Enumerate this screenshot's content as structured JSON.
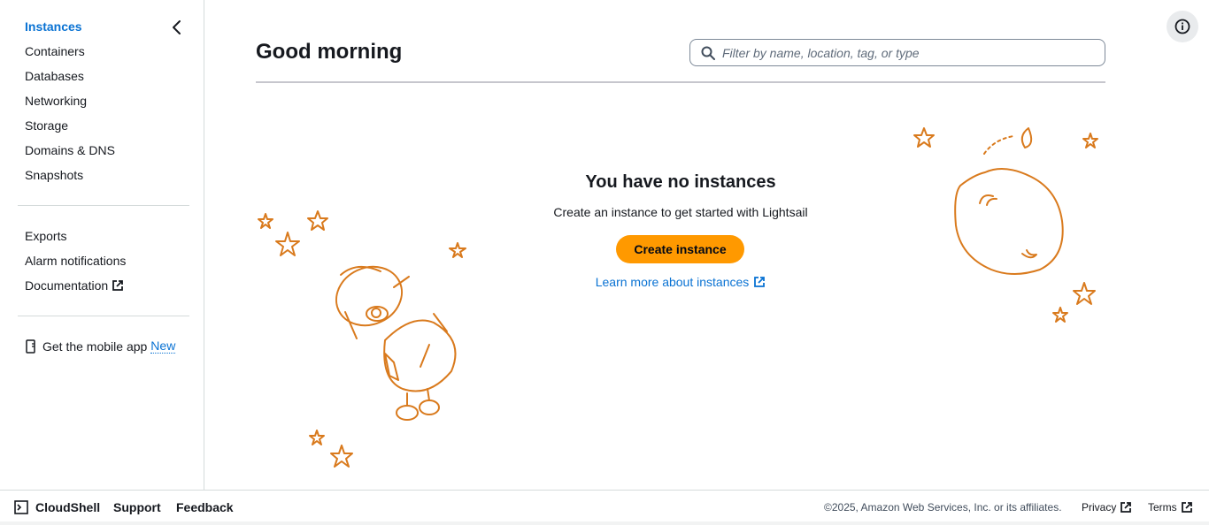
{
  "sidebar": {
    "items": [
      {
        "label": "Instances",
        "active": true
      },
      {
        "label": "Containers"
      },
      {
        "label": "Databases"
      },
      {
        "label": "Networking"
      },
      {
        "label": "Storage"
      },
      {
        "label": "Domains & DNS"
      },
      {
        "label": "Snapshots"
      }
    ],
    "secondary": [
      {
        "label": "Exports"
      },
      {
        "label": "Alarm notifications"
      },
      {
        "label": "Documentation",
        "external": true
      }
    ],
    "mobile_app": {
      "label": "Get the mobile app",
      "badge": "New"
    }
  },
  "header": {
    "title": "Good morning",
    "search_placeholder": "Filter by name, location, tag, or type"
  },
  "empty_state": {
    "title": "You have no instances",
    "subtitle": "Create an instance to get started with Lightsail",
    "create_button": "Create instance",
    "learn_link": "Learn more about instances"
  },
  "footer": {
    "cloudshell": "CloudShell",
    "support": "Support",
    "feedback": "Feedback",
    "copyright": "©2025, Amazon Web Services, Inc. or its affiliates.",
    "privacy": "Privacy",
    "terms": "Terms"
  },
  "colors": {
    "accent": "#0972d3",
    "primary_button": "#ff9900",
    "illustration": "#d97a1d"
  },
  "icons": [
    "chevron-left-icon",
    "search-icon",
    "info-icon",
    "external-link-icon",
    "mobile-icon",
    "cloudshell-icon",
    "robot-illustration",
    "planet-illustration",
    "star-icon"
  ]
}
